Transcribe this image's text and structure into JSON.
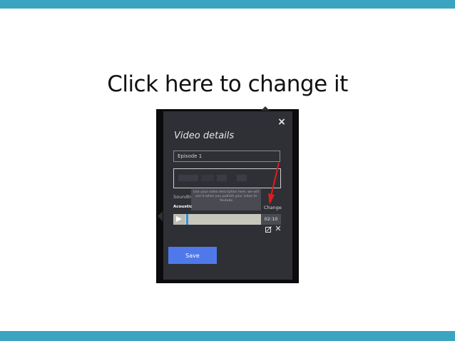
{
  "slide": {
    "title": "Click here to change it"
  },
  "dialog": {
    "heading": "Video details",
    "close_icon": "×",
    "title_field_value": "Episode 1",
    "tooltip_text": "Use your video description here, we will use it when you publish your video to Youtube",
    "soundtrack_label": "Soundtrack",
    "track_name": "Acoustic",
    "change_label": "Change",
    "player": {
      "time": "02:10",
      "progress": 0.02
    },
    "remove_icon": "✕",
    "save_label": "Save"
  },
  "colors": {
    "accent_bar": "#3aa5c1",
    "panel_bg": "#2f3036",
    "save_button": "#4f79ea",
    "arrow": "#e11b1b"
  },
  "icons": [
    "close-icon",
    "play-icon",
    "edit-icon",
    "remove-icon",
    "red-arrow"
  ]
}
